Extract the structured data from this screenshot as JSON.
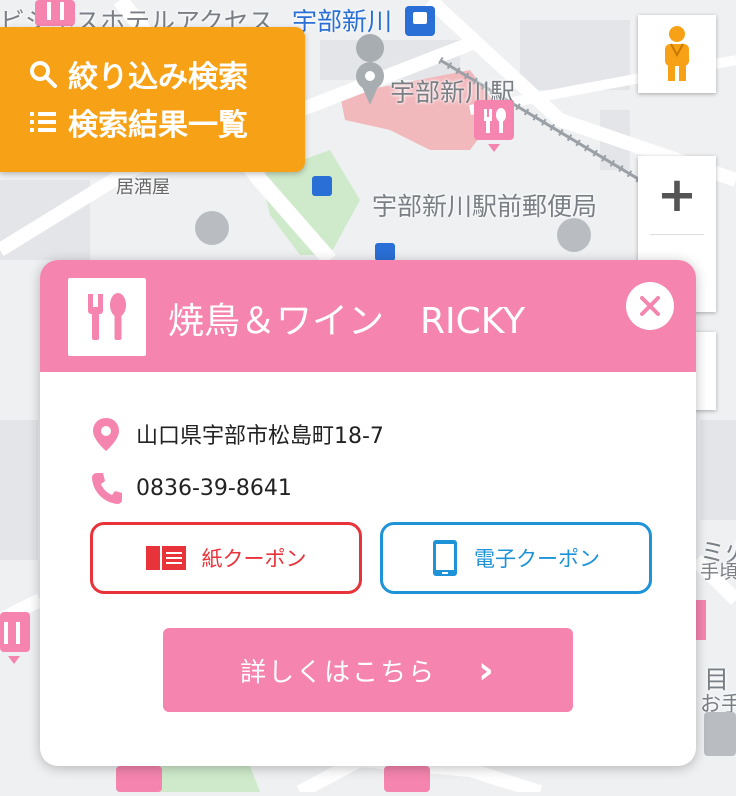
{
  "map": {
    "labels": {
      "hotel": "ビジネスホテルアクセス",
      "station_top": "宇部新川",
      "station": "宇部新川駅",
      "izakaya": "居酒屋",
      "post_office": "宇部新川駅前郵便局",
      "right1": "ミ火",
      "right2": "手頃",
      "right3": "目",
      "right4": "お手"
    }
  },
  "filter_panel": {
    "filter_label": "絞り込み検索",
    "list_label": "検索結果一覧"
  },
  "map_controls": {
    "zoom_in": "+"
  },
  "card": {
    "shop_name": "焼鳥＆ワイン　RICKY",
    "address": "山口県宇部市松島町18-7",
    "phone": "0836-39-8641",
    "paper_coupon_label": "紙クーポン",
    "digital_coupon_label": "電子クーポン",
    "details_label": "詳しくはこちら",
    "details_arrow": "›"
  },
  "colors": {
    "accent_pink": "#f585ae",
    "orange": "#f7a116",
    "paper_red": "#e8333a",
    "digital_blue": "#1f93d8"
  }
}
